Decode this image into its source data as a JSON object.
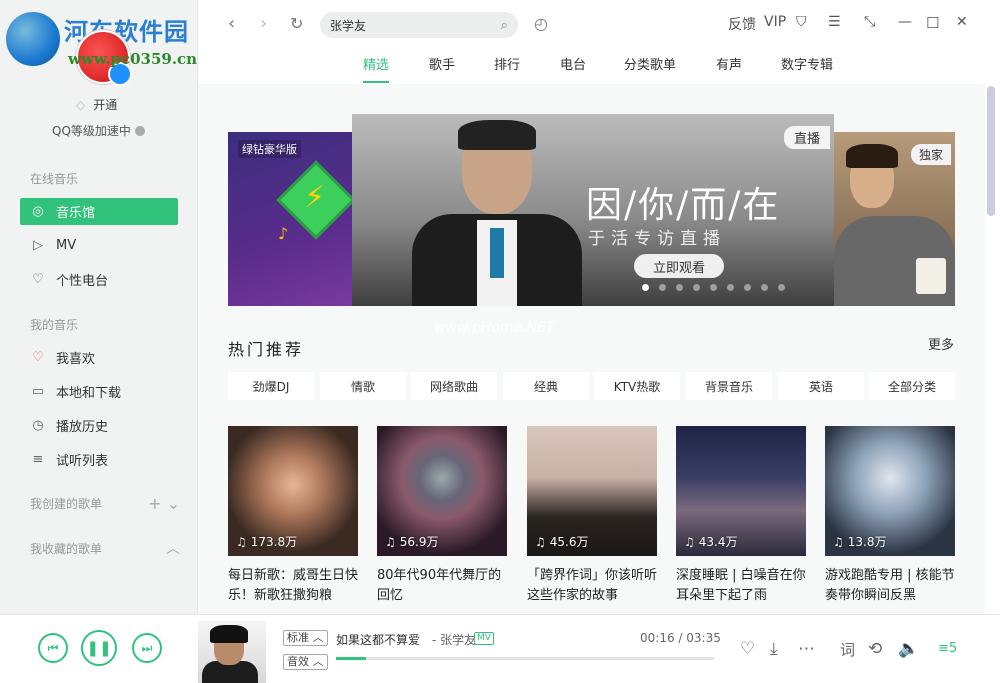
{
  "logo": {
    "site": "河东软件园",
    "url": "www.pc0359.cn"
  },
  "sidebar": {
    "vip_open": "开通",
    "qq_speed": "QQ等级加速中",
    "online_title": "在线音乐",
    "online": [
      {
        "label": "音乐馆",
        "icon": "music-hall-icon"
      },
      {
        "label": "MV",
        "icon": "mv-icon"
      },
      {
        "label": "个性电台",
        "icon": "radio-icon"
      }
    ],
    "mine_title": "我的音乐",
    "mine": [
      {
        "label": "我喜欢",
        "icon": "heart-icon"
      },
      {
        "label": "本地和下载",
        "icon": "monitor-icon"
      },
      {
        "label": "播放历史",
        "icon": "clock-icon"
      },
      {
        "label": "试听列表",
        "icon": "playlist-icon"
      }
    ],
    "created": "我创建的歌单",
    "collected": "我收藏的歌单"
  },
  "topbar": {
    "search_value": "张学友",
    "feedback": "反馈",
    "vip": "VIP",
    "tabs": [
      "精选",
      "歌手",
      "排行",
      "电台",
      "分类歌单",
      "有声",
      "数字专辑"
    ],
    "active_tab": "精选"
  },
  "banner": {
    "left_label": "绿钻豪华版",
    "title": "因/你/而/在",
    "subtitle": "于活专访直播",
    "watch": "立即观看",
    "live": "直播",
    "exclusive": "独家",
    "dots": 9,
    "active_dot": 0
  },
  "watermark": "www.pHome.NET",
  "hot": {
    "title": "热门推荐",
    "more": "更多",
    "categories": [
      "劲爆DJ",
      "情歌",
      "网络歌曲",
      "经典",
      "KTV热歌",
      "背景音乐",
      "英语",
      "全部分类"
    ],
    "cards": [
      {
        "plays": "173.8万",
        "desc": "每日新歌：威哥生日快乐！新歌狂撒狗粮"
      },
      {
        "plays": "56.9万",
        "desc": "80年代90年代舞厅的回忆"
      },
      {
        "plays": "45.6万",
        "desc": "「跨界作词」你该听听这些作家的故事"
      },
      {
        "plays": "43.4万",
        "desc": "深度睡眠 | 白噪音在你耳朵里下起了雨"
      },
      {
        "plays": "13.8万",
        "desc": "游戏跑酷专用 | 核能节奏带你瞬间反黑"
      }
    ]
  },
  "player": {
    "quality": "标准",
    "effect": "音效",
    "song": "如果这都不算爱",
    "artist": "- 张学友",
    "mv": "MV",
    "time": "00:16 / 03:35",
    "progress": 0.08,
    "lyric_btn": "词",
    "queue_count": "5"
  },
  "colors": {
    "accent": "#31c27c"
  }
}
